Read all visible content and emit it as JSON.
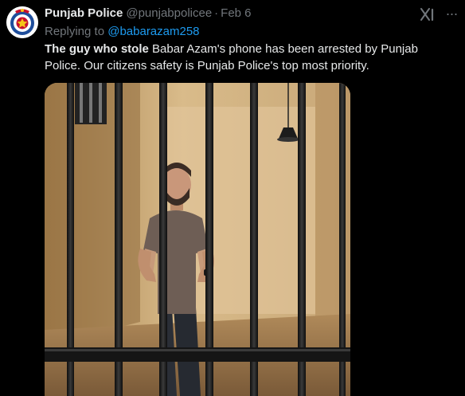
{
  "tweet": {
    "author_name": "Punjab Police",
    "author_handle": "@punjabpolicee",
    "separator": "·",
    "date": "Feb 6",
    "replying_prefix": "Replying to",
    "replying_handle": "@babarazam258",
    "text_bold": "The guy who stole",
    "text_rest": " Babar Azam's phone has been arrested by Punjab Police. Our citizens safety is Punjab Police's top most priority.",
    "more_label": "···"
  },
  "media": {
    "alt": "Man standing behind prison cell bars"
  },
  "icons": {
    "avatar": "punjab-police-emblem",
    "grok": "grok-icon",
    "more": "more-icon"
  },
  "colors": {
    "background": "#000000",
    "text": "#e7e9ea",
    "secondary": "#71767b",
    "link": "#1d9bf0"
  }
}
